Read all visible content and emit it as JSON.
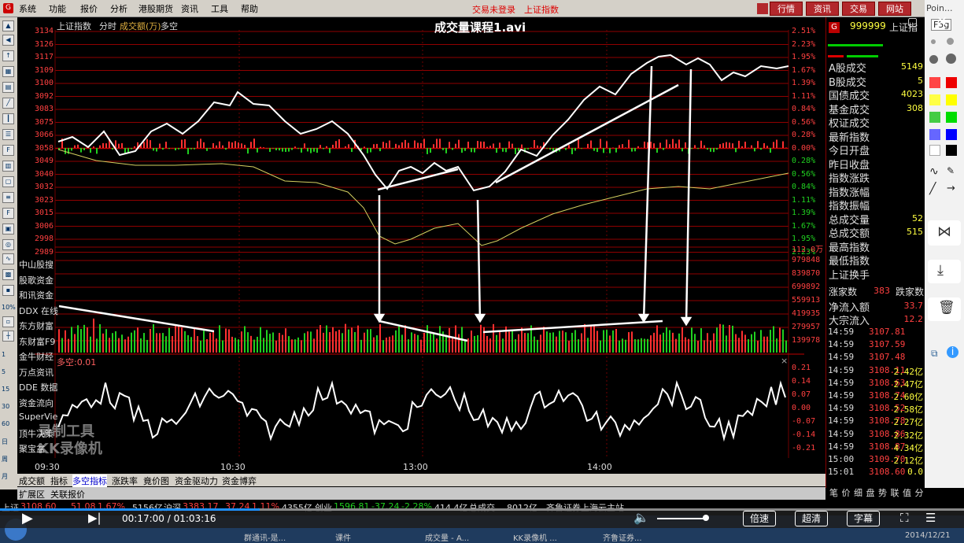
{
  "menu": {
    "items": [
      "系统",
      "功能",
      "报价",
      "分析",
      "港股期货",
      "资讯",
      "工具",
      "帮助"
    ],
    "status": [
      "交易未登录",
      "上证指数"
    ],
    "right_buttons": [
      "行情",
      "资讯",
      "交易",
      "网站"
    ]
  },
  "video_title": "成交量课程1.avi",
  "chart_header": {
    "name": "上证指数",
    "items": [
      "分时",
      "成交额(万)",
      "多空"
    ]
  },
  "left_prices": [
    "3134",
    "3126",
    "3117",
    "3109",
    "3100",
    "3092",
    "3083",
    "3075",
    "3066",
    "3058",
    "3049",
    "3040",
    "3032",
    "3023",
    "3015",
    "3006",
    "2998",
    "2989"
  ],
  "right_pcts": [
    "2.51%",
    "2.23%",
    "1.95%",
    "1.67%",
    "1.39%",
    "1.11%",
    "0.84%",
    "0.56%",
    "0.28%",
    "0.00%",
    "0.28%",
    "0.56%",
    "0.84%",
    "1.11%",
    "1.39%",
    "1.67%",
    "1.95%",
    "2.23%"
  ],
  "volume_labels": [
    "112.0万",
    "979848",
    "839870",
    "699892",
    "559913",
    "419935",
    "279957",
    "139978"
  ],
  "indicator_header": "多空:0.01",
  "indicator_labels": [
    "0.21",
    "0.14",
    "0.07",
    "0.00",
    "-0.07",
    "-0.14",
    "-0.21"
  ],
  "time_labels": [
    "09:30",
    "10:30",
    "13:00",
    "14:00"
  ],
  "left_menu": [
    "中山股搜",
    "股歌资金",
    "和讯资金",
    "DDX 在线",
    "东方财富",
    "东财富F9",
    "金牛财经",
    "万点资讯",
    "DDE 数据",
    "资金流向",
    "SuperVie",
    "顶牛决策",
    "聚宝盆"
  ],
  "left_nums": [
    "10%",
    "1",
    "5",
    "15",
    "30",
    "60",
    "日",
    "周",
    "月"
  ],
  "bottom_tabs": [
    "成交额",
    "指标",
    "多空指标",
    "涨跌率",
    "竟价图",
    "资金驱动力",
    "资金博弈"
  ],
  "bottom_tabs2": [
    "扩展区",
    "关联报价"
  ],
  "watermark": [
    "录制工具",
    "KK录像机"
  ],
  "right_panel": {
    "code": "999999",
    "name": "上证指",
    "labels": [
      "A股成交",
      "B股成交",
      "国债成交",
      "基金成交",
      "权证成交",
      "最新指数",
      "今日开盘",
      "昨日收盘",
      "指数涨跌",
      "指数涨幅",
      "指数振幅",
      "总成交量",
      "总成交额",
      "最高指数",
      "最低指数",
      "上证换手"
    ],
    "values": [
      "5149",
      "5",
      "4023",
      "308",
      "",
      "",
      "",
      "",
      "",
      "",
      "",
      "52",
      "515",
      "",
      "",
      ""
    ],
    "up_label": "涨家数",
    "up_value": "383",
    "down_label": "跌家数",
    "flow_labels": [
      "净流入额",
      "大宗流入"
    ],
    "flow_values": [
      "33.7",
      "12.2"
    ],
    "ticks": [
      {
        "t": "14:59",
        "p": "3107.81",
        "v": ""
      },
      {
        "t": "14:59",
        "p": "3107.59",
        "v": ""
      },
      {
        "t": "14:59",
        "p": "3107.48",
        "v": ""
      },
      {
        "t": "14:59",
        "p": "3108.11",
        "v": "2.42亿"
      },
      {
        "t": "14:59",
        "p": "3108.63",
        "v": "2.47亿"
      },
      {
        "t": "14:59",
        "p": "3108.74",
        "v": "2.60亿"
      },
      {
        "t": "14:59",
        "p": "3108.52",
        "v": "2.58亿"
      },
      {
        "t": "14:59",
        "p": "3108.78",
        "v": "2.27亿"
      },
      {
        "t": "14:59",
        "p": "3108.86",
        "v": "2.32亿"
      },
      {
        "t": "14:59",
        "p": "3108.87",
        "v": "4.34亿"
      },
      {
        "t": "15:00",
        "p": "3109.70",
        "v": "2.12亿"
      },
      {
        "t": "15:01",
        "p": "3108.60",
        "v": "0.0"
      }
    ],
    "bottom": [
      "笔",
      "价",
      "细",
      "盘",
      "势",
      "联",
      "值",
      "分"
    ]
  },
  "status_bar": {
    "sh": "上证",
    "sh_val": "3108.60",
    "sh_chg": "51.08",
    "sh_pct": "1.67%",
    "sh_amt": "5156亿",
    "sz": "沪深",
    "sz_val": "3383.17",
    "sz_chg": "37.24",
    "sz_pct": "1.11%",
    "sz_amt": "4355亿",
    "cy": "创业",
    "cy_val": "1596.81",
    "cy_chg": "-37.24",
    "cy_pct": "-2.28%",
    "cy_amt": "414.4亿",
    "total": "总成交",
    "total_amt": "8012亿",
    "broker": "齐鲁证券上海云主站"
  },
  "player": {
    "time": "00:17:00 / 01:03:16",
    "buttons": [
      "倍速",
      "超清",
      "字幕"
    ]
  },
  "taskbar": {
    "items": [
      "群通讯-是...",
      "课件",
      "成交量 - A...",
      "KK录像机 ...",
      "齐鲁证券..."
    ],
    "date": "2014/12/21"
  },
  "tools_header": "Poin...",
  "tools_label": "F5g"
}
